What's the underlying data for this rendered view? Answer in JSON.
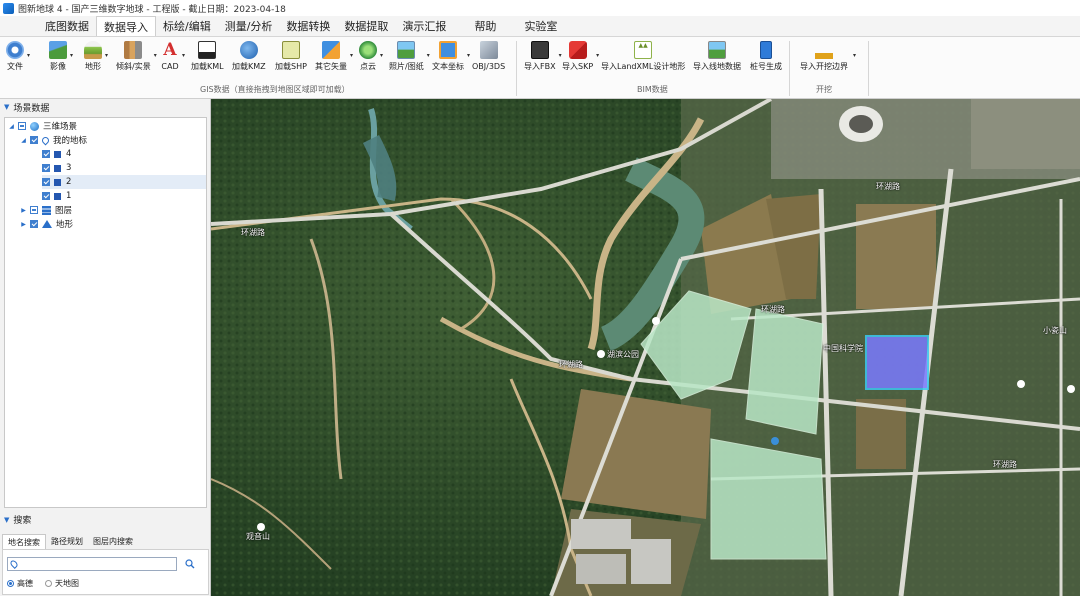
{
  "window": {
    "title": "图新地球 4 - 国产三维数字地球 - 工程版 - 截止日期：2023-04-18"
  },
  "menu": {
    "tabs": [
      {
        "label": "底图数据",
        "active": false
      },
      {
        "label": "数据导入",
        "active": true
      },
      {
        "label": "标绘/编辑",
        "active": false
      },
      {
        "label": "测量/分析",
        "active": false
      },
      {
        "label": "数据转换",
        "active": false
      },
      {
        "label": "数据提取",
        "active": false
      },
      {
        "label": "演示汇报",
        "active": false
      },
      {
        "label": "帮助",
        "active": false
      },
      {
        "label": "实验室",
        "active": false
      }
    ]
  },
  "ribbon": {
    "file": {
      "label": "文件",
      "icon": "gear-icon"
    },
    "gis_buttons": [
      {
        "label": "影像",
        "icon": "imagery-icon"
      },
      {
        "label": "地形",
        "icon": "terrain-icon"
      },
      {
        "label": "倾斜/实景",
        "icon": "oblique-icon"
      },
      {
        "label": "CAD",
        "icon": "cad-icon"
      },
      {
        "label": "加载KML",
        "icon": "kml-icon"
      },
      {
        "label": "加载KMZ",
        "icon": "kmz-icon"
      },
      {
        "label": "加载SHP",
        "icon": "shp-icon"
      },
      {
        "label": "其它矢量",
        "icon": "vector-icon"
      },
      {
        "label": "点云",
        "icon": "pointcloud-icon"
      },
      {
        "label": "照片/图纸",
        "icon": "photo-icon"
      },
      {
        "label": "文本坐标",
        "icon": "text-coord-icon"
      },
      {
        "label": "OBJ/3DS",
        "icon": "obj-icon"
      }
    ],
    "gis_group_label": "GIS数据（直接拖拽到地图区域即可加载）",
    "bim_buttons": [
      {
        "label": "导入FBX",
        "icon": "fbx-icon"
      },
      {
        "label": "导入SKP",
        "icon": "skp-icon"
      },
      {
        "label": "导入LandXML设计地形",
        "icon": "landxml-icon"
      },
      {
        "label": "导入线地数据",
        "icon": "line-data-icon"
      },
      {
        "label": "桩号生成",
        "icon": "station-icon"
      }
    ],
    "bim_group_label": "BIM数据",
    "dig_buttons": [
      {
        "label": "导入开挖边界",
        "icon": "excavator-icon"
      }
    ],
    "dig_group_label": "开挖"
  },
  "scene_panel": {
    "header": "场景数据",
    "tree": {
      "root": "三维场景",
      "my_places": "我的地标",
      "places": [
        "4",
        "3",
        "2",
        "1"
      ],
      "selected_place": "2",
      "layers": "图层",
      "terrain": "地形"
    }
  },
  "search_panel": {
    "header": "搜索",
    "tabs": [
      "地名搜索",
      "路径规划",
      "图层内搜索"
    ],
    "active_tab": "地名搜索",
    "input_value": "",
    "input_placeholder": "",
    "radio_options": [
      {
        "label": "高德",
        "selected": true
      },
      {
        "label": "天地图",
        "selected": false
      }
    ]
  },
  "map_labels": {
    "road_1": "环湖路",
    "road_2": "环湖路",
    "road_3": "环湖路",
    "poi_1": "湖滨公园",
    "poi_2": "中国科学院",
    "road_4": "环湖路",
    "road_5": "环湖路",
    "hill": "观音山",
    "poi_3": "小瓷山"
  },
  "colors": {
    "accent": "#2a6fc9",
    "highlight_region": "#7a7aff",
    "planned_parcel": "#b9e7c6"
  }
}
